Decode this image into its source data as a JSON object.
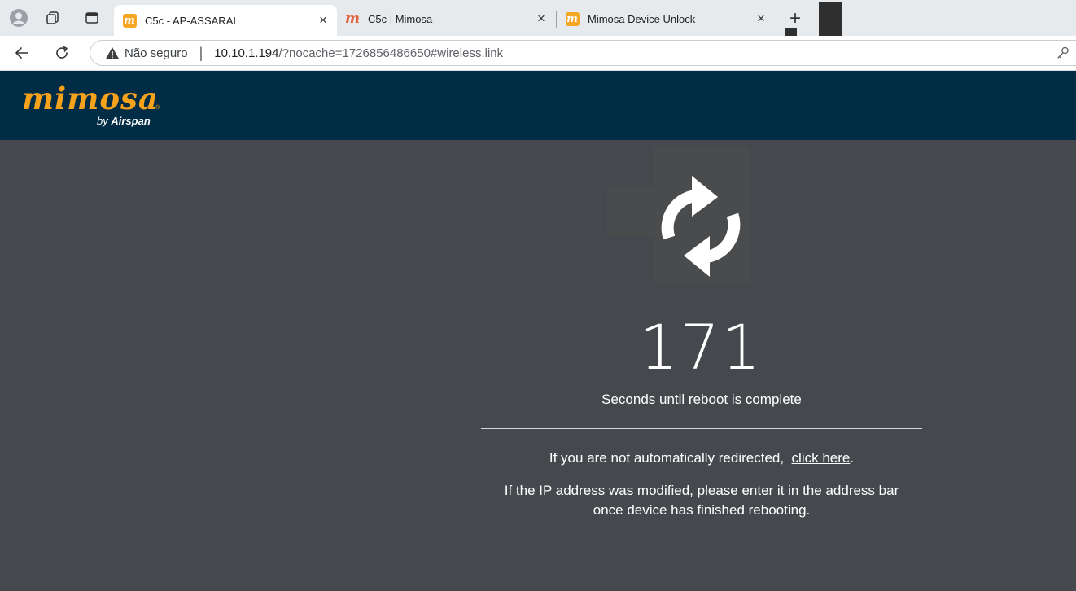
{
  "browser": {
    "tabs": [
      {
        "title": "C5c - AP-ASSARAI",
        "favicon": "mimosa-box-icon",
        "active": true
      },
      {
        "title": "C5c | Mimosa",
        "favicon": "mimosa-m-icon",
        "active": false
      },
      {
        "title": "Mimosa Device Unlock",
        "favicon": "mimosa-box-icon",
        "active": false
      }
    ],
    "close_glyph": "×",
    "new_tab_glyph": "+",
    "address": {
      "security_label": "Não seguro",
      "separator": "|",
      "host": "10.10.1.194",
      "path": "/?nocache=1726856486650#wireless.link"
    }
  },
  "header": {
    "logo_word": "mimosa",
    "logo_by": "by",
    "logo_brand": "Airspan",
    "logo_reg": "®"
  },
  "reboot": {
    "seconds": "171",
    "caption": "Seconds until reboot is complete",
    "redirect_prefix": "If you are not automatically redirected,",
    "redirect_link": "click here",
    "redirect_suffix": ".",
    "ip_note_line1": "If the IP address was modified, please enter it in the address bar",
    "ip_note_line2": "once device has finished rebooting."
  },
  "colors": {
    "header_bg": "#002c45",
    "brand_orange": "#f7a21b",
    "content_bg": "#45494d"
  }
}
